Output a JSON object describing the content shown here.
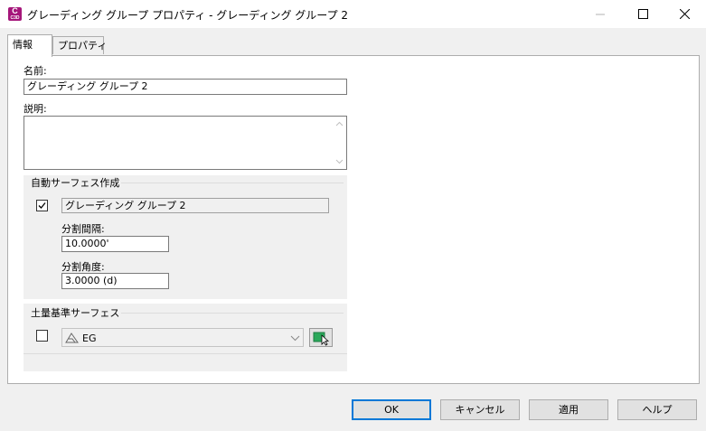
{
  "window": {
    "app_icon_letter": "C",
    "app_icon_sub": "C3D",
    "title": "グレーディング グループ プロパティ - グレーディング グループ 2"
  },
  "tabs": [
    {
      "label": "情報",
      "active": true
    },
    {
      "label": "プロパティ",
      "active": false
    }
  ],
  "info": {
    "name_label": "名前:",
    "name_value": "グレーディング グループ 2",
    "description_label": "説明:",
    "description_value": ""
  },
  "auto_surface": {
    "group_title": "自動サーフェス作成",
    "checked": true,
    "surface_name": "グレーディング グループ 2",
    "tessellation_spacing_label": "分割間隔:",
    "tessellation_spacing_value": "10.0000'",
    "tessellation_angle_label": "分割角度:",
    "tessellation_angle_value": "3.0000 (d)"
  },
  "base_surface": {
    "group_title": "土量基準サーフェス",
    "checked": false,
    "selected_surface": "EG"
  },
  "buttons": {
    "ok": "OK",
    "cancel": "キャンセル",
    "apply": "適用",
    "help": "ヘルプ"
  },
  "colors": {
    "accent": "#0078d7",
    "app_icon": "#a5167a"
  }
}
